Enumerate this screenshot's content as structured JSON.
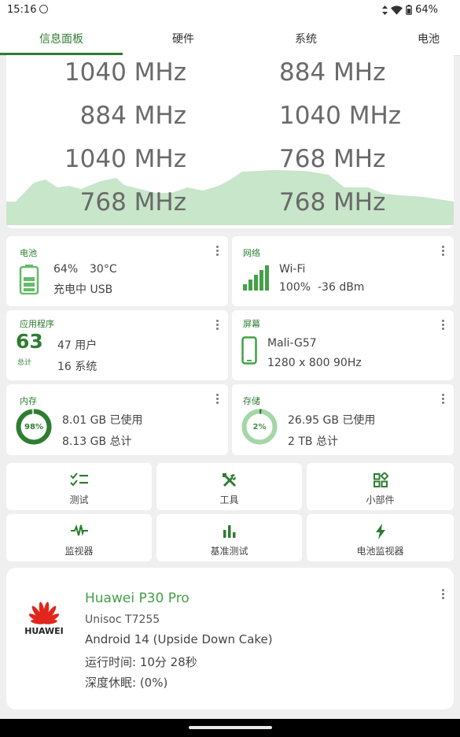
{
  "status_bar": {
    "time": "15:16",
    "battery": "64%"
  },
  "tabs": [
    {
      "label": "信息面板",
      "active": true
    },
    {
      "label": "硬件"
    },
    {
      "label": "系统"
    },
    {
      "label": "电池"
    }
  ],
  "cpu": {
    "freqs_left": [
      "1040 MHz",
      "884 MHz",
      "1040 MHz",
      "768 MHz"
    ],
    "freqs_right": [
      "884 MHz",
      "1040 MHz",
      "768 MHz",
      "768 MHz"
    ],
    "graph_color": "#c8e6c9"
  },
  "battery_tile": {
    "title": "电池",
    "level": "64%",
    "temp": "30°C",
    "status": "充电中 USB"
  },
  "network_tile": {
    "title": "网络",
    "type": "Wi-Fi",
    "signal": "100%",
    "dbm": "-36 dBm"
  },
  "apps_tile": {
    "title": "应用程序",
    "total": "63",
    "total_label": "总计",
    "user": "47 用户",
    "system": "16 系统"
  },
  "screen_tile": {
    "title": "屏幕",
    "gpu": "Mali-G57",
    "resolution": "1280 x 800",
    "refresh": "90Hz"
  },
  "memory_tile": {
    "title": "内存",
    "percent": "98%",
    "percent_value": 98,
    "used": "8.01 GB 已使用",
    "total": "8.13 GB 总计"
  },
  "storage_tile": {
    "title": "存储",
    "percent": "2%",
    "percent_value": 2,
    "used": "26.95 GB 已使用",
    "total": "2 TB 总计"
  },
  "quick_actions": {
    "test": "测试",
    "tools": "工具",
    "widgets": "小部件",
    "monitor": "监视器",
    "benchmark": "基准测试",
    "battery_monitor": "电池监视器"
  },
  "device": {
    "brand": "HUAWEI",
    "model": "Huawei P30 Pro",
    "soc": "Unisoc T7255",
    "android": "Android 14 (Upside Down Cake)",
    "uptime": "运行时间: 10分 28秒",
    "deep_sleep": "深度休眠:  (0%)"
  },
  "colors": {
    "accent": "#2e7d32",
    "accent_light": "#81c784",
    "background": "#efefef"
  }
}
